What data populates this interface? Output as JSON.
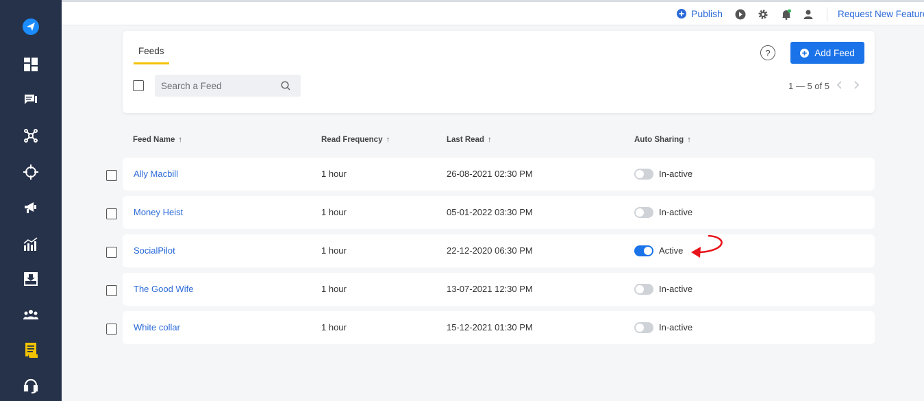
{
  "topbar": {
    "publish_label": "Publish",
    "request_label": "Request New Feature"
  },
  "card": {
    "tab_label": "Feeds",
    "help_label": "?",
    "add_button_label": "Add Feed",
    "search_placeholder": "Search a Feed",
    "pagination": "1 — 5 of 5"
  },
  "table": {
    "columns": [
      "Feed Name",
      "Read Frequency",
      "Last Read",
      "Auto Sharing"
    ],
    "sort_glyph": "↑",
    "rows": [
      {
        "name": "Ally Macbill",
        "frequency": "1 hour",
        "last_read": "26-08-2021 02:30 PM",
        "auto_sharing": "In-active",
        "active": false
      },
      {
        "name": "Money Heist",
        "frequency": "1 hour",
        "last_read": "05-01-2022 03:30 PM",
        "auto_sharing": "In-active",
        "active": false
      },
      {
        "name": "SocialPilot",
        "frequency": "1 hour",
        "last_read": "22-12-2020 06:30 PM",
        "auto_sharing": "Active",
        "active": true
      },
      {
        "name": "The Good Wife",
        "frequency": "1 hour",
        "last_read": "13-07-2021 12:30 PM",
        "auto_sharing": "In-active",
        "active": false
      },
      {
        "name": "White collar",
        "frequency": "1 hour",
        "last_read": "15-12-2021 01:30 PM",
        "auto_sharing": "In-active",
        "active": false
      }
    ]
  },
  "sidebar_icons": [
    "send-icon",
    "dashboard-icon",
    "messages-icon",
    "connections-icon",
    "target-icon",
    "megaphone-icon",
    "analytics-icon",
    "download-icon",
    "team-icon",
    "feeds-icon",
    "support-icon"
  ],
  "colors": {
    "sidebar_bg": "#26324a",
    "accent": "#1a73e8",
    "link": "#2b6ad8",
    "tab_underline": "#f2c200",
    "active_sidebar_icon": "#f2c200",
    "annotation_arrow": "#e8141b"
  }
}
